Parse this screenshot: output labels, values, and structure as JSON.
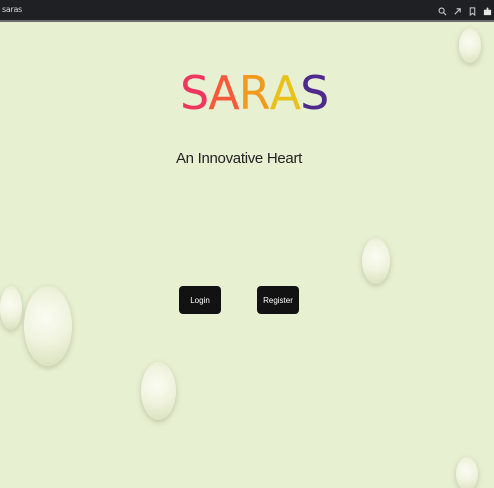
{
  "window": {
    "title": "saras"
  },
  "topbar_icons": [
    {
      "name": "search-icon"
    },
    {
      "name": "share-icon"
    },
    {
      "name": "bookmark-icon"
    },
    {
      "name": "extensions-icon"
    }
  ],
  "brand": {
    "letters": [
      {
        "char": "S",
        "color": "#f0355f"
      },
      {
        "char": "A",
        "color": "#f75a3a"
      },
      {
        "char": "R",
        "color": "#f29a1e"
      },
      {
        "char": "A",
        "color": "#e8c21a"
      },
      {
        "char": "S",
        "color": "#4d2a8c"
      }
    ]
  },
  "tagline": "An Innovative Heart",
  "actions": {
    "login_label": "Login",
    "register_label": "Register"
  },
  "colors": {
    "background": "#e8f0d2",
    "button": "#121212",
    "topbar": "#1f2023"
  }
}
